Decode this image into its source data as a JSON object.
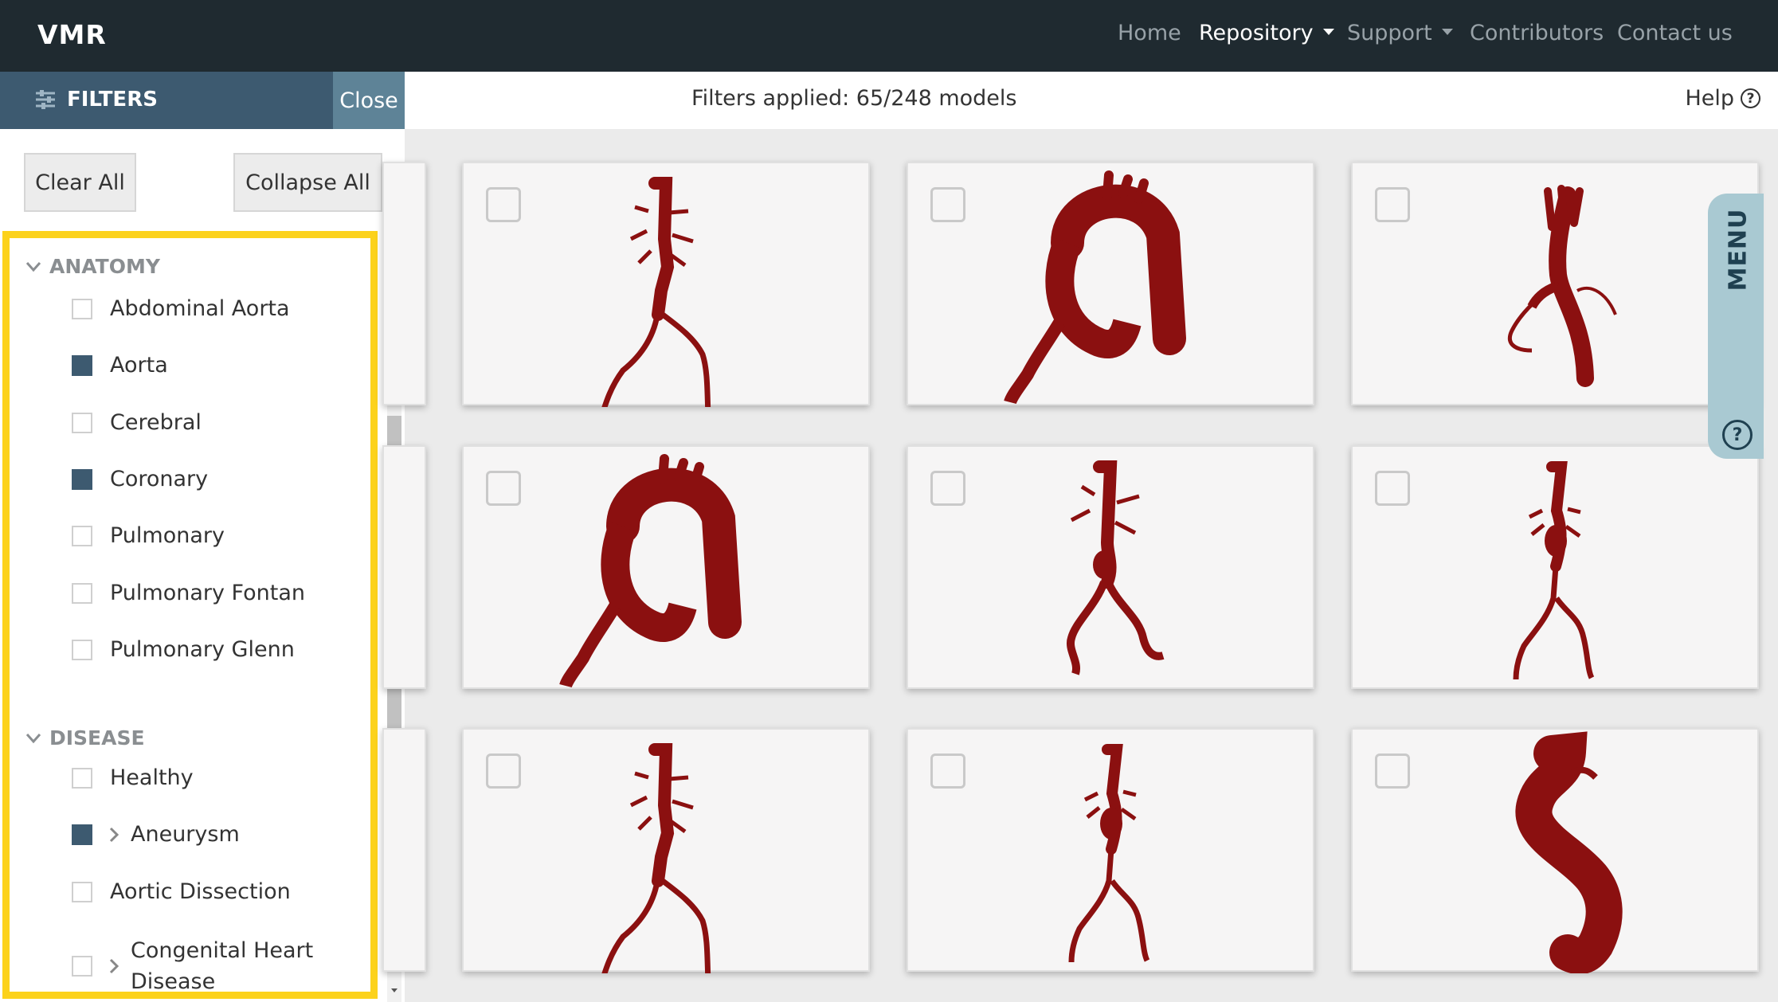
{
  "navbar": {
    "brand": "VMR",
    "links": [
      {
        "label": "Home"
      },
      {
        "label": "Repository"
      },
      {
        "label": "Support"
      },
      {
        "label": "Contributors"
      },
      {
        "label": "Contact us"
      }
    ],
    "active": "Repository"
  },
  "filters": {
    "title": "FILTERS",
    "close_label": "Close",
    "clear_all_label": "Clear All",
    "collapse_all_label": "Collapse All",
    "sections": [
      {
        "title": "ANATOMY",
        "items": [
          {
            "label": "Abdominal Aorta",
            "checked": false
          },
          {
            "label": "Aorta",
            "checked": true
          },
          {
            "label": "Cerebral",
            "checked": false
          },
          {
            "label": "Coronary",
            "checked": true
          },
          {
            "label": "Pulmonary",
            "checked": false
          },
          {
            "label": "Pulmonary Fontan",
            "checked": false
          },
          {
            "label": "Pulmonary Glenn",
            "checked": false
          }
        ]
      },
      {
        "title": "DISEASE",
        "items": [
          {
            "label": "Healthy",
            "checked": false
          },
          {
            "label": "Aneurysm",
            "checked": true,
            "expandable": true
          },
          {
            "label": "Aortic Dissection",
            "checked": false
          },
          {
            "label": "Congenital Heart",
            "label_line2": "Disease",
            "checked": false,
            "expandable": true
          }
        ]
      }
    ],
    "highlight_color": "#fcd21c"
  },
  "topbar": {
    "filters_applied": "Filters applied: 65/248 models",
    "help_label": "Help",
    "help_icon": "question-circle-icon"
  },
  "menu_tab": {
    "label": "MENU",
    "help_icon": "question-circle-icon"
  },
  "grid": {
    "model_color": "#8b1010",
    "cards": [
      {
        "model": "abdominal-aorta-model",
        "selected": false
      },
      {
        "model": "aortic-arch-model",
        "selected": false
      },
      {
        "model": "aorta-branches-model",
        "selected": false
      },
      {
        "model": "aortic-arch-model-2",
        "selected": false
      },
      {
        "model": "abdominal-aorta-model-2",
        "selected": false
      },
      {
        "model": "abdominal-aorta-model-3",
        "selected": false
      },
      {
        "model": "abdominal-aorta-model-4",
        "selected": false
      },
      {
        "model": "abdominal-aorta-model-5",
        "selected": false
      },
      {
        "model": "aortic-aneurysm-model",
        "selected": false
      }
    ]
  },
  "colors": {
    "navbar_bg": "#1f2a30",
    "filters_header_bg": "#3d5a70",
    "close_bg": "#5e8397",
    "checked": "#3d5a70",
    "menu_tab_bg": "#a9c9d2"
  }
}
